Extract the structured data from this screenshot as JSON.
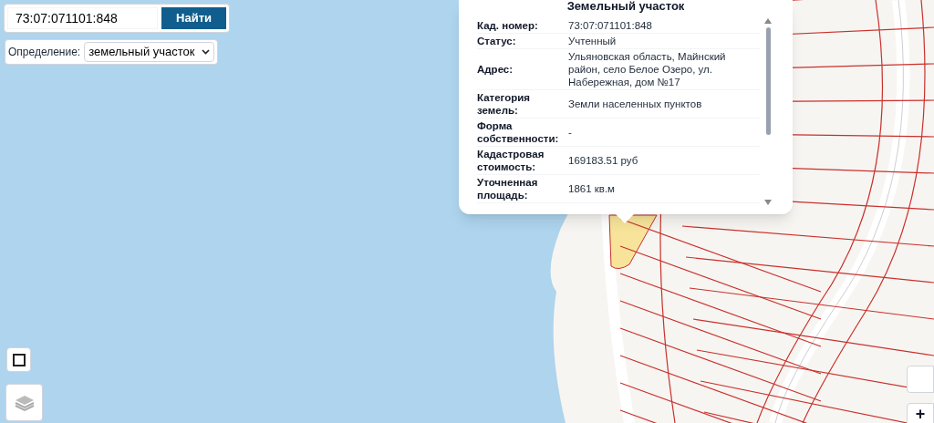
{
  "search": {
    "value": "73:07:071101:848",
    "button": "Найти"
  },
  "mode": {
    "label": "Определение:",
    "value": "земельный участок"
  },
  "popup": {
    "title": "Земельный участок",
    "rows": [
      {
        "label": "Кад. номер:",
        "value": "73:07:071101:848"
      },
      {
        "label": "Статус:",
        "value": "Учтенный"
      },
      {
        "label": "Адрес:",
        "value": "Ульяновская область, Майнский район, село Белое Озеро, ул. Набережная, дом №17"
      },
      {
        "label": "Категория земель:",
        "value": "Земли населенных пунктов"
      },
      {
        "label": "Форма собственности:",
        "value": "-"
      },
      {
        "label": "Кадастровая стоимость:",
        "value": "169183.51 руб"
      },
      {
        "label": "Уточненная площадь:",
        "value": "1861 кв.м"
      }
    ]
  },
  "zoom": {
    "plus": "+"
  }
}
